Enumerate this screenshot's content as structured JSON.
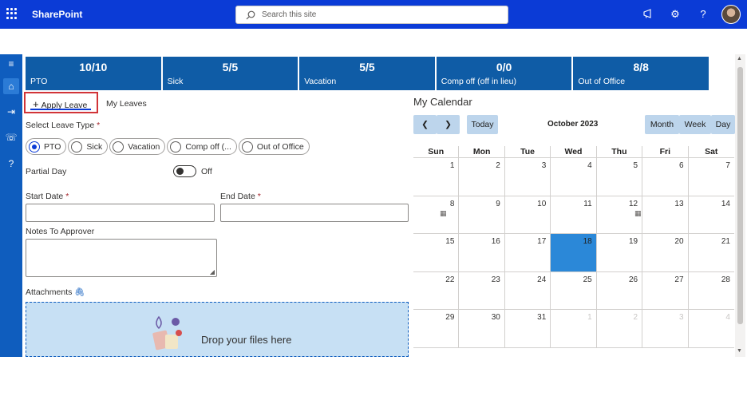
{
  "header": {
    "brand": "SharePoint",
    "search_placeholder": "Search this site"
  },
  "tiles": [
    {
      "value": "10/10",
      "label": "PTO"
    },
    {
      "value": "5/5",
      "label": "Sick"
    },
    {
      "value": "5/5",
      "label": "Vacation"
    },
    {
      "value": "0/0",
      "label": "Comp off (off in lieu)"
    },
    {
      "value": "8/8",
      "label": "Out of Office"
    }
  ],
  "tabs": {
    "apply": "Apply Leave",
    "apply_icon": "+",
    "my_leaves": "My Leaves"
  },
  "form": {
    "leave_type_label": "Select Leave Type",
    "required_mark": "*",
    "leave_types": [
      "PTO",
      "Sick",
      "Vacation",
      "Comp off (...",
      "Out of Office"
    ],
    "selected_type": "PTO",
    "partial_day_label": "Partial Day",
    "partial_day_state": "Off",
    "start_date_label": "Start Date",
    "end_date_label": "End Date",
    "notes_label": "Notes To Approver",
    "attachments_label": "Attachments",
    "drop_text": "Drop your files here"
  },
  "calendar": {
    "title": "My Calendar",
    "today_label": "Today",
    "month_label": "October 2023",
    "views": [
      "Month",
      "Week",
      "Day"
    ],
    "weekdays": [
      "Sun",
      "Mon",
      "Tue",
      "Wed",
      "Thu",
      "Fri",
      "Sat"
    ],
    "weeks": [
      [
        "1",
        "2",
        "3",
        "4",
        "5",
        "6",
        "7"
      ],
      [
        "8",
        "9",
        "10",
        "11",
        "12",
        "13",
        "14"
      ],
      [
        "15",
        "16",
        "17",
        "18",
        "19",
        "20",
        "21"
      ],
      [
        "22",
        "23",
        "24",
        "25",
        "26",
        "27",
        "28"
      ],
      [
        "29",
        "30",
        "31",
        "1",
        "2",
        "3",
        "4"
      ]
    ],
    "today": "18",
    "highlight_color": "#2b88d8"
  },
  "colors": {
    "topbar": "#0b3bd6",
    "tile": "#0f5ca6",
    "accent": "#0b3bd6",
    "highlight_border": "#d13438"
  },
  "icons": {
    "waffle": "waffle-icon",
    "search": "search-icon",
    "megaphone": "megaphone-icon",
    "settings": "gear-icon",
    "help": "help-icon",
    "calendar": "calendar-icon",
    "attach": "paperclip-icon"
  }
}
